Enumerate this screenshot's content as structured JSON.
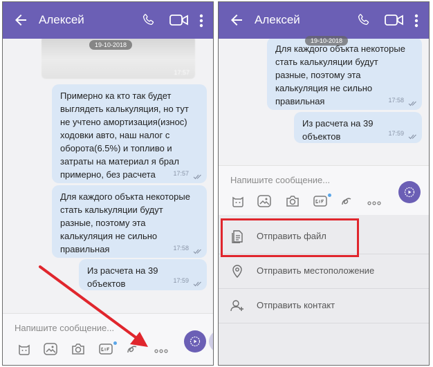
{
  "left": {
    "header": {
      "contact_name": "Алексей"
    },
    "date_label": "19-10-2018",
    "photo_time": "17:57",
    "messages": [
      {
        "text": "Примерно ка кто так будет\nвыглядеть калькуляция, но тут\nне учтено амортизация(износ)\nходовки авто, наш налог с\nоборота(6.5%) и топливо и\nзатраты на материал я брал\nпримерно, без расчета",
        "time": "17:57"
      },
      {
        "text": "Для каждого объкта некоторые\nстать калькуляции будут\nразные, поэтому эта\nкалькуляция не сильно\nправильная",
        "time": "17:58"
      },
      {
        "text": "Из расчета на 39 объектов",
        "time": "17:59"
      }
    ],
    "composer": {
      "placeholder": "Напишите сообщение..."
    }
  },
  "right": {
    "header": {
      "contact_name": "Алексей"
    },
    "date_label": "19-10-2018",
    "messages": [
      {
        "text": "Для каждого объкта некоторые\nстать калькуляции будут\nразные, поэтому эта\nкалькуляция не сильно\nправильная",
        "time": "17:58"
      },
      {
        "text": "Из расчета на 39 объектов",
        "time": "17:59"
      }
    ],
    "composer": {
      "placeholder": "Напишите сообщение..."
    },
    "attach_menu": [
      {
        "icon": "file-icon",
        "label": "Отправить файл"
      },
      {
        "icon": "location-pin-icon",
        "label": "Отправить местоположение"
      },
      {
        "icon": "add-contact-icon",
        "label": "Отправить контакт"
      }
    ]
  },
  "colors": {
    "header": "#6b5fb5",
    "bubble": "#dae7f6",
    "chat_bg": "#f2f2f4",
    "annotation_red": "#e0262d"
  }
}
